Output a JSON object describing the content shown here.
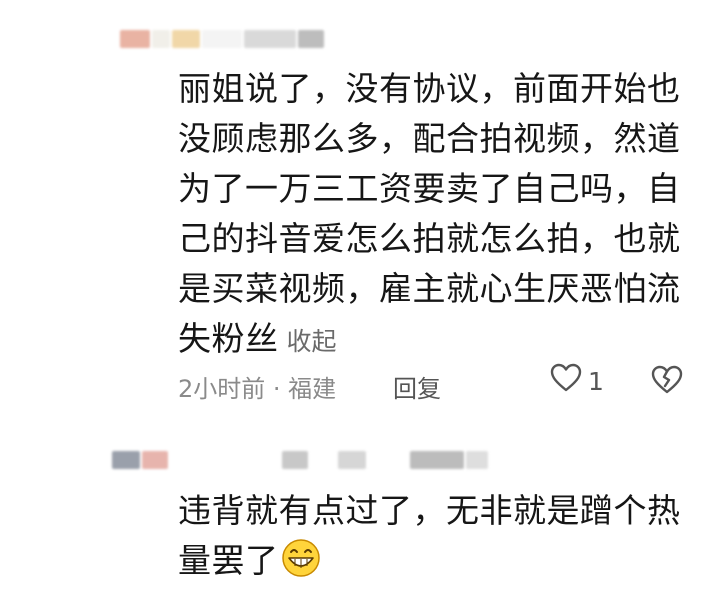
{
  "comment1": {
    "name_blocks": [
      {
        "w": 30,
        "color": "#e9b3a3"
      },
      {
        "w": 18,
        "color": "#f1efe9"
      },
      {
        "w": 28,
        "color": "#f1d7a8"
      },
      {
        "w": 40,
        "color": "#f4f4f4"
      },
      {
        "w": 52,
        "color": "#d9d9d9"
      },
      {
        "w": 26,
        "color": "#bdbdbd"
      }
    ],
    "lines": [
      "丽姐说了，没有协议，前面开始也",
      "没顾虑那么多，配合拍视频，然道",
      "为了一万三工资要卖了自己吗，自",
      "己的抖音爱怎么拍就怎么拍，也就",
      "是买菜视频，雇主就心生厌恶怕流",
      "失粉丝"
    ],
    "collapse_label": "收起",
    "time_location": "2小时前 · 福建",
    "reply_label": "回复",
    "like_count": "1"
  },
  "comment2": {
    "name_blocks": [
      {
        "w": 28,
        "color": "#9aa0ab"
      },
      {
        "w": 26,
        "color": "#e7b4ad"
      },
      {
        "w": 110,
        "color": "#ffffff"
      },
      {
        "w": 26,
        "color": "#c8c8c8"
      },
      {
        "w": 26,
        "color": "#ffffff"
      },
      {
        "w": 28,
        "color": "#d6d6d6"
      },
      {
        "w": 40,
        "color": "#ffffff"
      },
      {
        "w": 54,
        "color": "#bcbcbc"
      },
      {
        "w": 22,
        "color": "#dedede"
      }
    ],
    "lines": [
      "违背就有点过了，无非就是蹭个热",
      "量罢了"
    ]
  },
  "colors": {
    "text": "#161616",
    "meta": "#8a8a8a",
    "collapse": "#6a6a6a",
    "emoji_face": "#ffd43b"
  },
  "icons": {
    "like": "heart-outline-icon",
    "dislike": "broken-heart-icon",
    "emoji": "grinning-face-icon"
  }
}
